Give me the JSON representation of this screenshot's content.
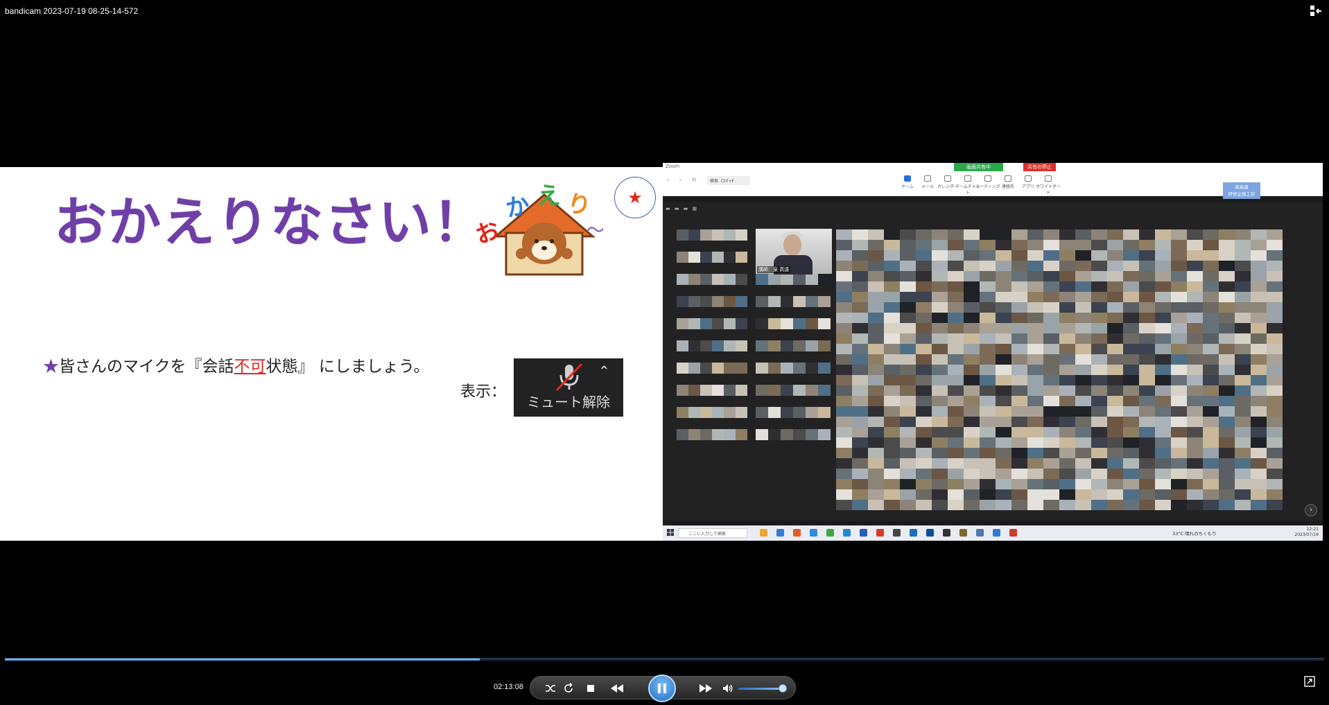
{
  "window": {
    "title": "bandicam 2023-07-19 08-25-14-572"
  },
  "slide": {
    "title": "おかえりなさい！",
    "mascot_text": "おかえり〜",
    "instruction_lead": "★",
    "instruction_before": "皆さんのマイクを『会話",
    "instruction_red": "不可",
    "instruction_after": "状態』 にしましょう。",
    "display_label": "表示：",
    "unmute_label": "ミュート解除"
  },
  "zoom": {
    "app_label": "Zoom",
    "share_status": "画面共有中",
    "stop_share": "共有の停止",
    "search_placeholder": "検索",
    "search_shortcut": "Ctrl+F",
    "toolbar": [
      "ホーム",
      "メール",
      "カレンダー",
      "チームチャット",
      "ミーティング",
      "連絡先",
      "アプリ",
      "ホワイトボード"
    ],
    "org_line1": "泉高遠",
    "org_line2": "研修企画工房",
    "speaker_name": "講師：泉 高遠",
    "taskbar_search": "ここに入力して検索",
    "weather": "33°C 晴れのちくもり",
    "tray_time": "12:21",
    "tray_date": "2023/07/19"
  },
  "player": {
    "timecode": "02:13:08",
    "progress": 0.36,
    "volume": 0.85,
    "accent": "#3a88d8"
  },
  "colors": {
    "title_purple": "#6f3fa7",
    "red": "#e0261b"
  }
}
